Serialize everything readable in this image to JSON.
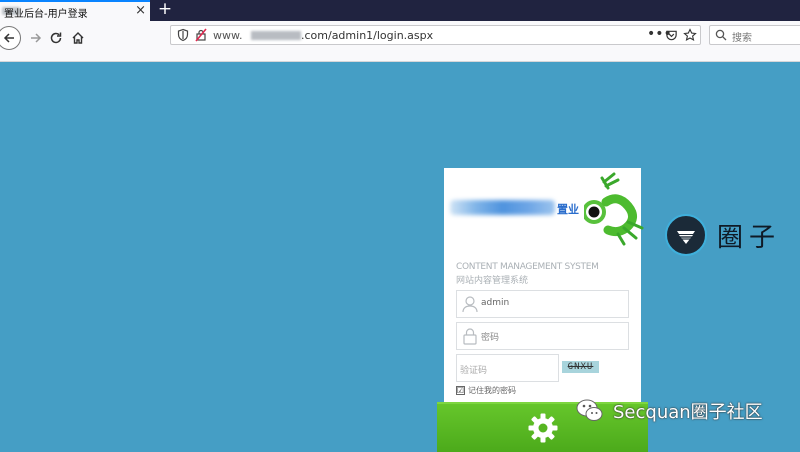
{
  "tab": {
    "title": "置业后台-用户登录",
    "close": "×",
    "new_tab": "+"
  },
  "toolbar": {
    "url_prefix": "www.",
    "url_path": ".com/admin1/login.aspx",
    "page_actions": "•••",
    "search_placeholder": "搜索"
  },
  "login": {
    "logo_suffix": "置业",
    "heading_en": "CONTENT MANAGEMENT SYSTEM",
    "heading_cn": "网站内容管理系统",
    "username_value": "admin",
    "password_placeholder": "密码",
    "captcha_placeholder": "验证码",
    "captcha_code": "GNXU",
    "remember_checked": "☑",
    "remember_label": "记住我的密码"
  },
  "watermarks": {
    "brand_cn": "圈子",
    "wechat_label": "Secquan圈子社区"
  },
  "colors": {
    "page_bg": "#459ec5",
    "login_button": "#56b521",
    "tab_accent": "#0a84ff"
  }
}
